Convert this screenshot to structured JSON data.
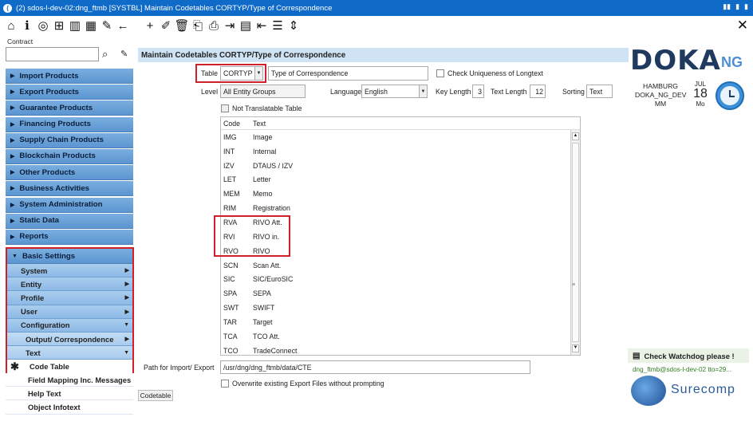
{
  "window": {
    "title": "(2) sdos-l-dev-02:dng_ftmb [SYSTBL] Maintain Codetables CORTYP/Type of Correspondence",
    "controls": [
      "▮▮",
      "▮",
      "▮"
    ]
  },
  "toolbar": {
    "icons": [
      "home-icon",
      "info-icon",
      "target-icon",
      "tree-icon",
      "book-icon",
      "grid-icon",
      "edit-icon",
      "back-icon",
      "add-icon",
      "pencil-icon",
      "delete-icon",
      "folder-icon",
      "print-icon",
      "export-icon",
      "log-icon",
      "import-icon",
      "document-icon",
      "collapse-icon"
    ],
    "close_glyph": "✕"
  },
  "contract": {
    "label": "Contract",
    "value": ""
  },
  "nav": {
    "items": [
      "Import Products",
      "Export Products",
      "Guarantee Products",
      "Financing Products",
      "Supply Chain Products",
      "Blockchain Products",
      "Other Products",
      "Business Activities",
      "System Administration",
      "Static Data",
      "Reports"
    ],
    "basic": {
      "label": "Basic Settings",
      "subs": [
        "System",
        "Entity",
        "Profile",
        "User"
      ],
      "configuration": "Configuration",
      "output": "Output/ Correspondence",
      "text": "Text",
      "code_table": "Code Table"
    },
    "tail": [
      "Field Mapping Inc. Messages",
      "Help Text",
      "Object Infotext"
    ]
  },
  "form": {
    "header": "Maintain Codetables CORTYP/Type of Correspondence",
    "table_label": "Table",
    "table_value": "CORTYP",
    "table_desc": "Type of Correspondence",
    "check_unique": "Check Uniqueness of Longtext",
    "level_label": "Level",
    "level_value": "All Entity Groups",
    "language_label": "Language",
    "language_value": "English",
    "keylen_label": "Key Length",
    "keylen_value": "3",
    "textlen_label": "Text Length",
    "textlen_value": "12",
    "sorting_label": "Sorting",
    "sorting_value": "Text",
    "not_translatable": "Not Translatable Table",
    "path_label": "Path for Import/ Export",
    "path_value": "/usr/dng/dng_ftmb/data/CTE",
    "overwrite": "Overwrite existing Export Files without prompting",
    "tab": "Codetable"
  },
  "grid": {
    "headers": [
      "Code",
      "Text"
    ],
    "rows": [
      [
        "IMG",
        "Image"
      ],
      [
        "INT",
        "Internal"
      ],
      [
        "IZV",
        "DTAUS / IZV"
      ],
      [
        "LET",
        "Letter"
      ],
      [
        "MEM",
        "Memo"
      ],
      [
        "RIM",
        "Registration"
      ],
      [
        "RVA",
        "RIVO Att."
      ],
      [
        "RVI",
        "RIVO in."
      ],
      [
        "RVO",
        "RIVO"
      ],
      [
        "SCN",
        "Scan Att."
      ],
      [
        "SIC",
        "SIC/EuroSIC"
      ],
      [
        "SPA",
        "SEPA"
      ],
      [
        "SWT",
        "SWIFT"
      ],
      [
        "TAR",
        "Target"
      ],
      [
        "TCA",
        "TCO Att."
      ],
      [
        "TCO",
        "TradeConnect"
      ]
    ]
  },
  "branding": {
    "logo_main": "DOKA",
    "logo_ng": "NG",
    "location": [
      "HAMBURG",
      "DOKA_NG_DEV",
      "MM"
    ],
    "month": "JUL",
    "day": "18",
    "weekday": "Mo",
    "watchdog": "Check Watchdog please !",
    "user_line": "dng_ftmb@sdos-l-dev-02 tto=29...",
    "surecomp": "Surecomp"
  }
}
